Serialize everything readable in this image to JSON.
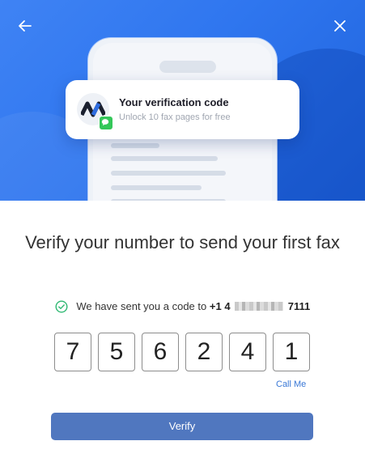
{
  "hero": {
    "back_icon": "arrow-left-icon",
    "close_icon": "close-icon",
    "notification": {
      "title": "Your verification code",
      "subtitle": "Unlock 10 fax pages for free",
      "app_icon": "app-logo-icon",
      "badge_icon": "message-icon"
    }
  },
  "headline": "Verify your number to send your first fax",
  "sent": {
    "text": "We have sent you a code to",
    "number_prefix": "+1",
    "number_masked_start": "4",
    "number_suffix": "7111",
    "icon": "check-circle-icon"
  },
  "code_digits": [
    "7",
    "5",
    "6",
    "2",
    "4",
    "1"
  ],
  "call_me_label": "Call Me",
  "verify_label": "Verify",
  "colors": {
    "hero_blue": "#2f76ef",
    "button_blue": "#5077bf",
    "link_blue": "#3a78d6",
    "success_green": "#2eb872"
  }
}
